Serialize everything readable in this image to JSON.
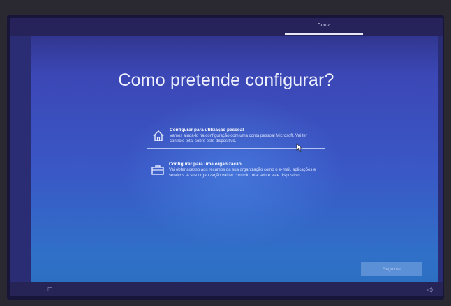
{
  "header": {
    "step_label": "Conta"
  },
  "main": {
    "title": "Como pretende configurar?",
    "options": [
      {
        "icon": "home-icon",
        "title": "Configurar para utilização pessoal",
        "description": "Vamos ajudá-lo na configuração com uma conta pessoal Microsoft. Vai ter controlo total sobre este dispositivo.",
        "selected": true
      },
      {
        "icon": "briefcase-icon",
        "title": "Configurar para uma organização",
        "description": "Vai obter acesso aos recursos da sua organização como o e-mail, aplicações e serviços. A sua organização vai ter controlo total sobre este dispositivo.",
        "selected": false
      }
    ]
  },
  "footer": {
    "next_label": "Seguinte"
  },
  "colors": {
    "background": "#3a58c6",
    "accent_button": "#5b8fd6",
    "text": "#eef0ff"
  }
}
